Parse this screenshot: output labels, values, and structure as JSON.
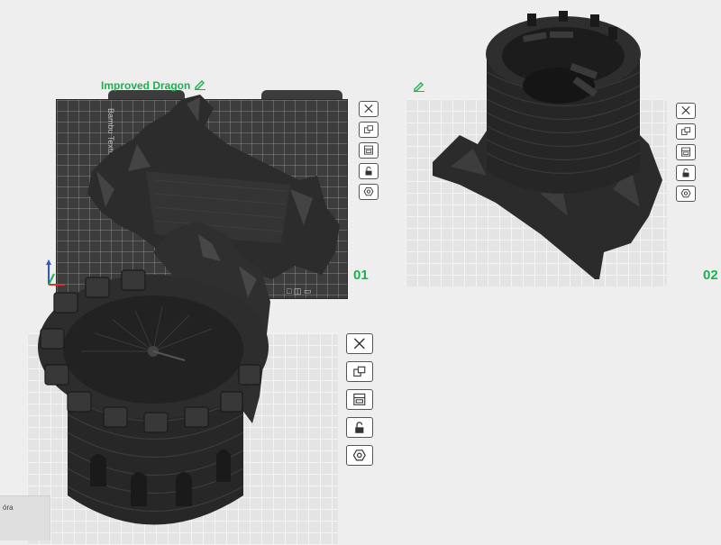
{
  "plates": [
    {
      "index": "01",
      "name": "Improved Dragon",
      "bed_text": "Bambu Textured PEI Plate"
    },
    {
      "index": "02",
      "name": ""
    },
    {
      "index": "",
      "name": ""
    }
  ],
  "plate_toolbar": [
    {
      "icon": "close-icon",
      "label": "Delete plate"
    },
    {
      "icon": "arrange-icon",
      "label": "Arrange objects"
    },
    {
      "icon": "orient-icon",
      "label": "Auto orient"
    },
    {
      "icon": "lock-icon",
      "label": "Lock plate"
    },
    {
      "icon": "settings-hex-icon",
      "label": "Plate settings"
    }
  ],
  "bed_status": "□ ◫ ▭",
  "bottom_left_label": "óra",
  "colors": {
    "accent": "#1ab24d",
    "plate_light": "#e4e4e4",
    "plate_dark": "#3c3c3c",
    "model": "#2b2b2b",
    "background": "#eeeeee"
  }
}
